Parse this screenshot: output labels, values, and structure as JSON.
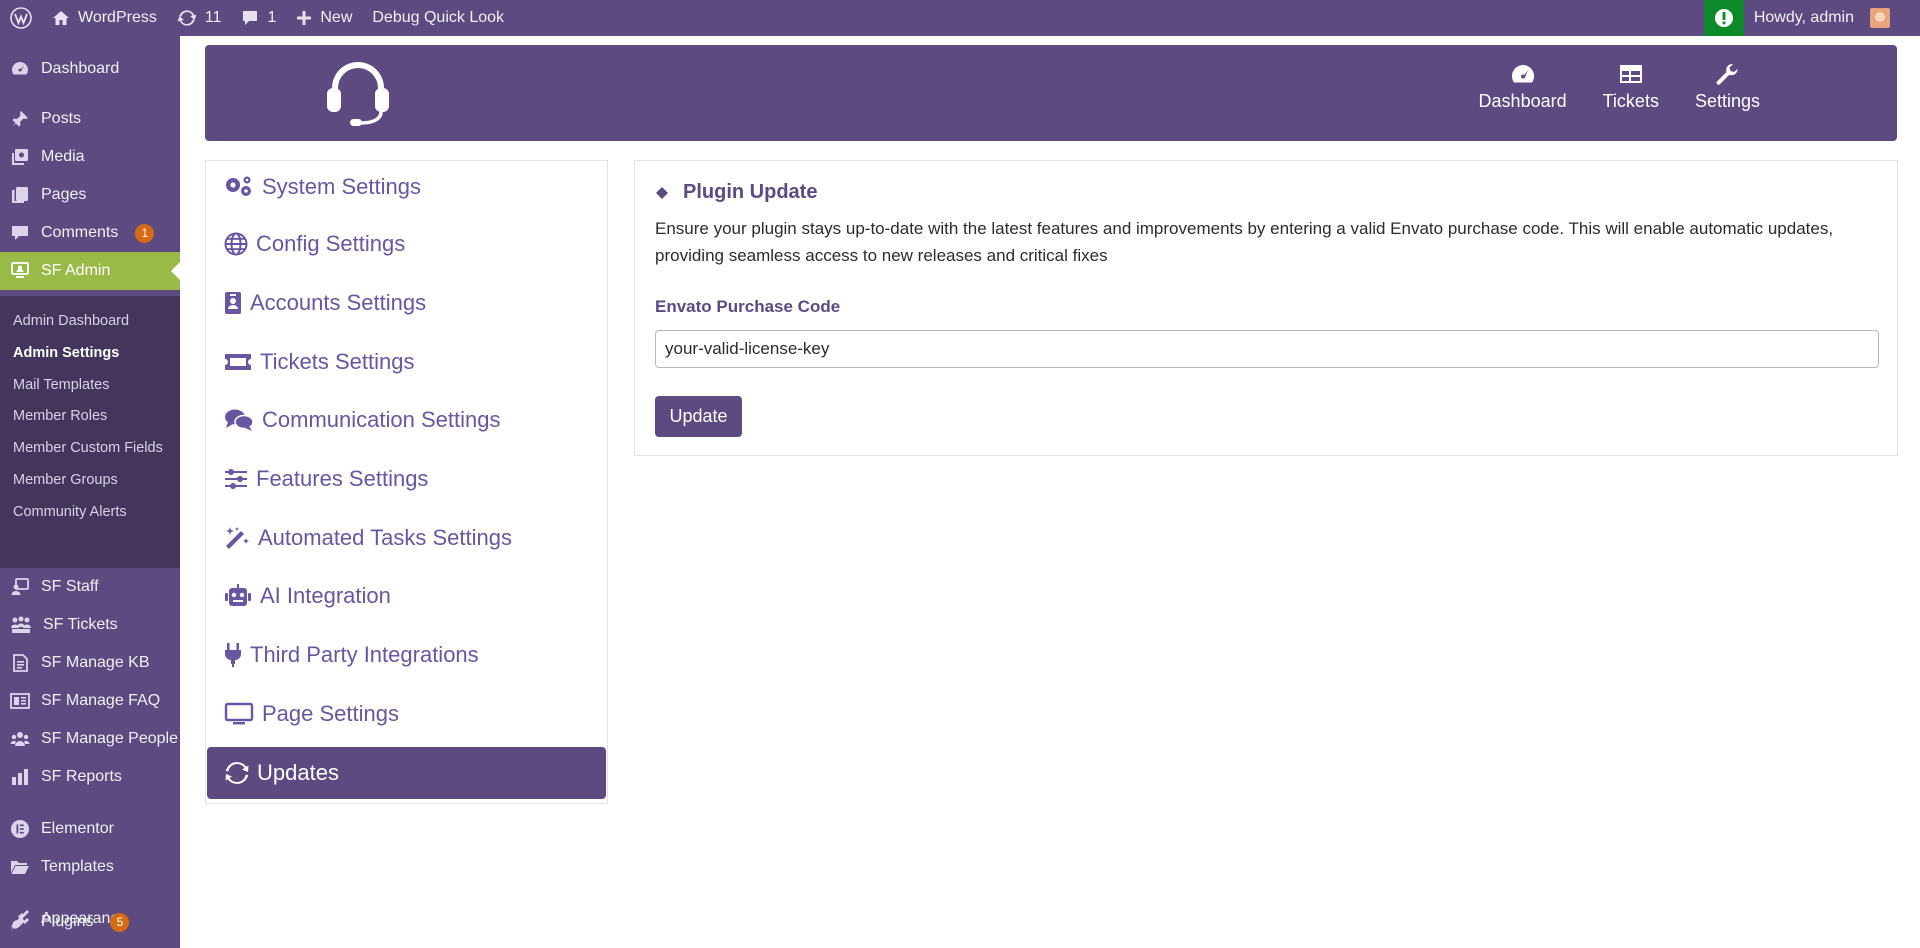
{
  "adminbar": {
    "site_name": "WordPress",
    "updates_count": "11",
    "comments_count": "1",
    "new_label": "New",
    "debug_label": "Debug Quick Look",
    "howdy": "Howdy, admin"
  },
  "sidebar": {
    "items": [
      {
        "label": "Dashboard",
        "icon": "dashboard-icon"
      },
      {
        "label": "Posts",
        "icon": "pin-icon"
      },
      {
        "label": "Media",
        "icon": "media-icon"
      },
      {
        "label": "Pages",
        "icon": "pages-icon"
      },
      {
        "label": "Comments",
        "icon": "comment-icon",
        "badge": "1"
      },
      {
        "label": "SF Admin",
        "icon": "admin-icon"
      },
      {
        "label": "SF Staff",
        "icon": "staff-icon"
      },
      {
        "label": "SF Tickets",
        "icon": "tickets-icon"
      },
      {
        "label": "SF Manage KB",
        "icon": "kb-icon"
      },
      {
        "label": "SF Manage FAQ",
        "icon": "faq-icon"
      },
      {
        "label": "SF Manage People",
        "icon": "people-icon"
      },
      {
        "label": "SF Reports",
        "icon": "reports-icon"
      },
      {
        "label": "Elementor",
        "icon": "elementor-icon"
      },
      {
        "label": "Templates",
        "icon": "folder-icon"
      },
      {
        "label": "Appearance",
        "icon": "brush-icon"
      },
      {
        "label": "Plugins",
        "icon": "plugin-icon",
        "badge": "5"
      }
    ],
    "submenu": [
      "Admin Dashboard",
      "Admin Settings",
      "Mail Templates",
      "Member Roles",
      "Member Custom Fields",
      "Member Groups",
      "Community Alerts"
    ]
  },
  "header_nav": [
    {
      "label": "Dashboard",
      "icon": "gauge-icon"
    },
    {
      "label": "Tickets",
      "icon": "table-icon"
    },
    {
      "label": "Settings",
      "icon": "wrench-icon"
    }
  ],
  "settings_nav": [
    {
      "label": "System Settings",
      "icon": "gears-icon"
    },
    {
      "label": "Config Settings",
      "icon": "globe-icon"
    },
    {
      "label": "Accounts Settings",
      "icon": "id-badge-icon"
    },
    {
      "label": "Tickets Settings",
      "icon": "ticket-icon"
    },
    {
      "label": "Communication Settings",
      "icon": "comments-icon"
    },
    {
      "label": "Features Settings",
      "icon": "sliders-icon"
    },
    {
      "label": "Automated Tasks Settings",
      "icon": "magic-wand-icon"
    },
    {
      "label": "AI Integration",
      "icon": "robot-icon"
    },
    {
      "label": "Third Party Integrations",
      "icon": "plug-icon"
    },
    {
      "label": "Page Settings",
      "icon": "monitor-icon"
    },
    {
      "label": "Updates",
      "icon": "sync-icon"
    }
  ],
  "panel": {
    "title": "Plugin Update",
    "description": "Ensure your plugin stays up-to-date with the latest features and improvements by entering a valid Envato purchase code. This will enable automatic updates, providing seamless access to new releases and critical fixes",
    "field_label": "Envato Purchase Code",
    "field_value": "your-valid-license-key",
    "button_label": "Update"
  },
  "colors": {
    "brand": "#5c4a80",
    "accent_green": "#9aba48",
    "link_purple": "#6a55a1",
    "badge_orange": "#d66a12"
  }
}
